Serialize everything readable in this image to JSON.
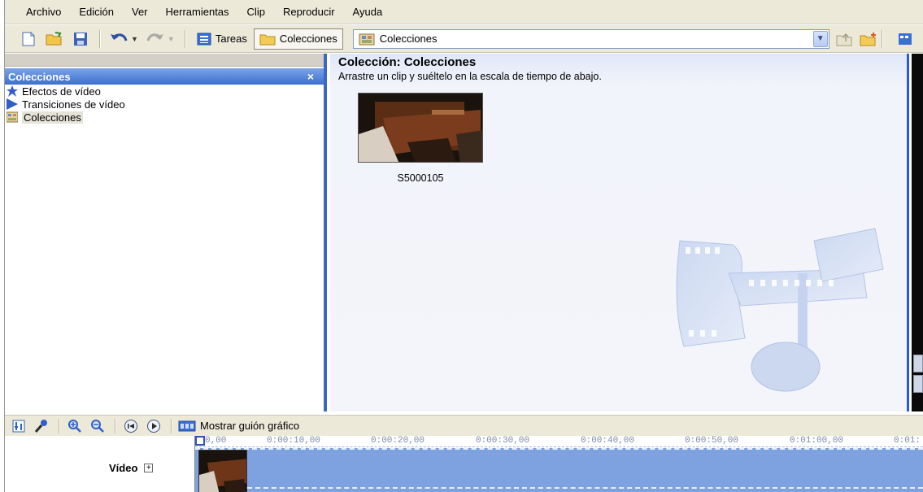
{
  "menu": {
    "items": [
      "Archivo",
      "Edición",
      "Ver",
      "Herramientas",
      "Clip",
      "Reproducir",
      "Ayuda"
    ]
  },
  "toolbar": {
    "tasks_label": "Tareas",
    "collections_label": "Colecciones",
    "combo_value": "Colecciones"
  },
  "left_panel": {
    "title": "Colecciones",
    "close": "×",
    "items": [
      {
        "label": "Efectos de vídeo",
        "icon": "star-icon"
      },
      {
        "label": "Transiciones de vídeo",
        "icon": "transition-icon"
      },
      {
        "label": "Colecciones",
        "icon": "collection-icon",
        "selected": true
      }
    ]
  },
  "main": {
    "title": "Colección: Colecciones",
    "subtitle": "Arrastre un clip y suéltelo en la escala de tiempo de abajo.",
    "clips": [
      {
        "name": "S5000105"
      }
    ]
  },
  "timeline": {
    "storyboard_label": "Mostrar guión gráfico",
    "track_label": "Vídeo",
    "ticks": [
      "0,00",
      "0:00:10,00",
      "0:00:20,00",
      "0:00:30,00",
      "0:00:40,00",
      "0:00:50,00",
      "0:01:00,00",
      "0:01:"
    ]
  },
  "colors": {
    "menu_bg": "#ece9d8",
    "panel_header": "#3c6fcf",
    "track_bg": "#7ea2e0",
    "accent_border": "#3a68c4"
  }
}
